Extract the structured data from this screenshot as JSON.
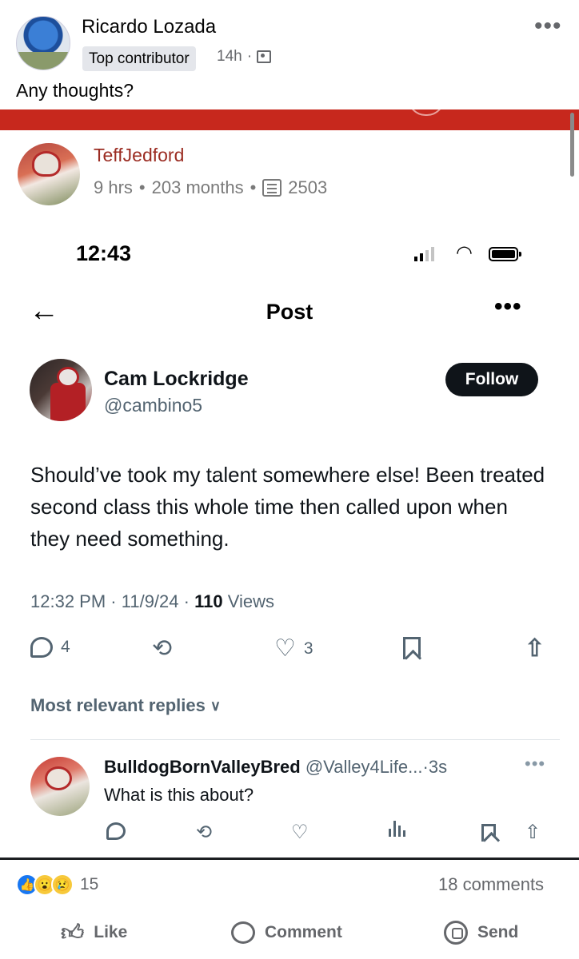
{
  "fb_post": {
    "author": "Ricardo Lozada",
    "badge": "Top contributor",
    "time": "14h",
    "separator": "·",
    "caption": "Any thoughts?",
    "more": "•••"
  },
  "shared": {
    "inner_post": {
      "author": "TeffJedford",
      "time": "9 hrs",
      "age": "203 months",
      "comments": "2503",
      "dot": "•"
    },
    "phone": {
      "time": "12:43"
    },
    "x_post": {
      "header_title": "Post",
      "back": "←",
      "more": "•••",
      "name": "Cam Lockridge",
      "handle": "@cambino5",
      "follow_label": "Follow",
      "text": "Should’ve took my talent somewhere else! Been treated second class this whole time then called upon when they need something.",
      "time": "12:32 PM",
      "date": "11/9/24",
      "views_count": "110",
      "views_label": "Views",
      "sep": "·",
      "replies": "4",
      "likes": "3",
      "retweet_glyph": "⟲",
      "heart_glyph": "♡",
      "share_glyph": "⇧",
      "sort_label": "Most relevant replies",
      "sort_chevron": "∨"
    },
    "reply": {
      "name": "BulldogBornValleyBred",
      "handle": "@Valley4Life...",
      "time": "3s",
      "sep": "·",
      "text": "What is this about?",
      "more": "•••",
      "retweet_glyph": "⟲",
      "heart_glyph": "♡",
      "share_glyph": "⇧"
    }
  },
  "fb_footer": {
    "reaction_count": "15",
    "comments_count": "18 comments",
    "like_label": "Like",
    "comment_label": "Comment",
    "send_label": "Send",
    "thumb_glyph": "👍"
  },
  "colors": {
    "facebook_blue": "#1877f2",
    "red_bar": "#c7281d",
    "x_dark": "#0f1419",
    "x_gray": "#536471"
  }
}
